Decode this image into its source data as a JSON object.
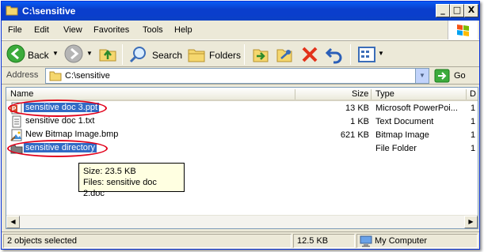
{
  "window": {
    "title": "C:\\sensitive",
    "controls": {
      "minimize": "_",
      "maximize": "□",
      "close": "X"
    }
  },
  "menu": [
    "File",
    "Edit",
    "View",
    "Favorites",
    "Tools",
    "Help"
  ],
  "toolbar": {
    "back_label": "Back",
    "search_label": "Search",
    "folders_label": "Folders"
  },
  "address": {
    "label": "Address",
    "path": "C:\\sensitive",
    "go_label": "Go"
  },
  "columns": [
    "Name",
    "Size",
    "Type",
    "D"
  ],
  "files": [
    {
      "name": "sensitive doc 3.ppt",
      "size": "13 KB",
      "type": "Microsoft PowerPoi...",
      "date": "1",
      "icon": "powerpoint-icon",
      "selected": true
    },
    {
      "name": "sensitive doc 1.txt",
      "size": "1 KB",
      "type": "Text Document",
      "date": "1",
      "icon": "text-file-icon",
      "selected": false
    },
    {
      "name": "New Bitmap Image.bmp",
      "size": "621 KB",
      "type": "Bitmap Image",
      "date": "1",
      "icon": "bitmap-icon",
      "selected": false
    },
    {
      "name": "sensitive directory",
      "size": "",
      "type": "File Folder",
      "date": "1",
      "icon": "folder-icon",
      "selected": true
    }
  ],
  "tooltip": {
    "size_line": "Size: 23.5 KB",
    "files_line": "Files: sensitive doc 2.doc"
  },
  "status": {
    "selection": "2 objects selected",
    "size": "12.5 KB",
    "location": "My Computer"
  },
  "colors": {
    "titlebar": "#0a3ecc",
    "selection": "#316ac5",
    "highlight_oval": "#e2001a",
    "tooltip_bg": "#ffffe1"
  }
}
